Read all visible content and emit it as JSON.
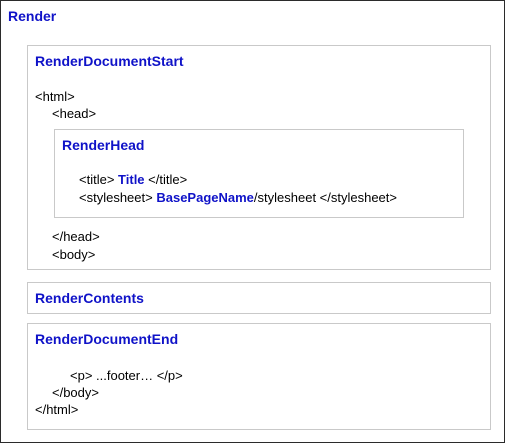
{
  "render": {
    "title": "Render",
    "document_start": {
      "title": "RenderDocumentStart",
      "lines": [
        "<html>",
        "<head>",
        "</head>",
        "<body>"
      ]
    },
    "head": {
      "title": "RenderHead",
      "title_line": {
        "open": "<title>",
        "var": "Title",
        "close": "</title>"
      },
      "stylesheet_line": {
        "open": "<stylesheet>",
        "var": "BasePageName",
        "rest": "/stylesheet </stylesheet>"
      }
    },
    "contents": {
      "title": "RenderContents"
    },
    "document_end": {
      "title": "RenderDocumentEnd",
      "lines": [
        "<p> ...footer… </p>",
        "</body>",
        "</html>"
      ]
    }
  }
}
